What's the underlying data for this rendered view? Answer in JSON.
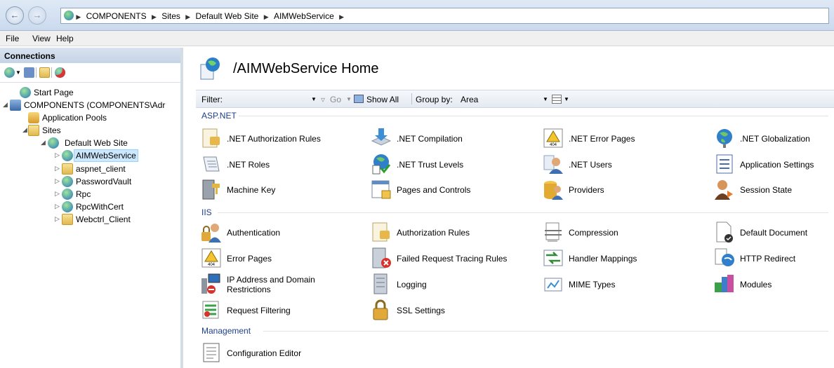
{
  "address": {
    "crumbs": [
      "COMPONENTS",
      "Sites",
      "Default Web Site",
      "AIMWebService"
    ]
  },
  "menu": [
    "File",
    "View",
    "Help"
  ],
  "connections": {
    "title": "Connections",
    "tree": [
      {
        "label": "Start Page"
      },
      {
        "label": "COMPONENTS (COMPONENTS\\Adr"
      },
      {
        "label": "Application Pools"
      },
      {
        "label": "Sites"
      },
      {
        "label": "Default Web Site"
      },
      {
        "label": "AIMWebService"
      },
      {
        "label": "aspnet_client"
      },
      {
        "label": "PasswordVault"
      },
      {
        "label": "Rpc"
      },
      {
        "label": "RpcWithCert"
      },
      {
        "label": "Webctrl_Client"
      }
    ]
  },
  "page": {
    "title": "/AIMWebService Home",
    "filter_label": "Filter:",
    "go_label": "Go",
    "show_all_label": "Show All",
    "group_by_label": "Group by:",
    "group_by_value": "Area"
  },
  "groups": [
    {
      "name": "ASP.NET",
      "features": [
        ".NET Authorization Rules",
        ".NET Compilation",
        ".NET Error Pages",
        ".NET Globalization",
        ".NET Roles",
        ".NET Trust Levels",
        ".NET Users",
        "Application Settings",
        "Machine Key",
        "Pages and Controls",
        "Providers",
        "Session State"
      ]
    },
    {
      "name": "IIS",
      "features": [
        "Authentication",
        "Authorization Rules",
        "Compression",
        "Default Document",
        "Error Pages",
        "Failed Request Tracing Rules",
        "Handler Mappings",
        "HTTP Redirect",
        "IP Address and Domain Restrictions",
        "Logging",
        "MIME Types",
        "Modules",
        "Request Filtering",
        "SSL Settings"
      ]
    },
    {
      "name": "Management",
      "features": [
        "Configuration Editor"
      ]
    }
  ]
}
